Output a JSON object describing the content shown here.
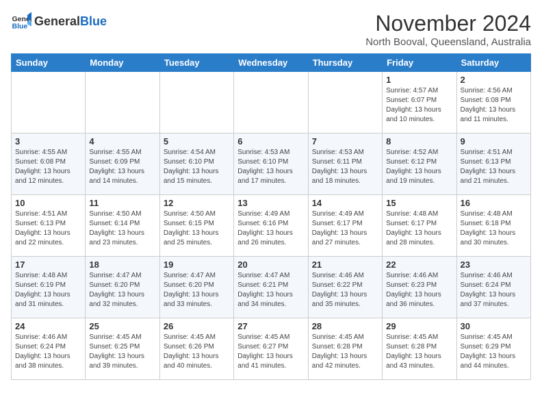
{
  "header": {
    "logo_general": "General",
    "logo_blue": "Blue",
    "month": "November 2024",
    "location": "North Booval, Queensland, Australia"
  },
  "weekdays": [
    "Sunday",
    "Monday",
    "Tuesday",
    "Wednesday",
    "Thursday",
    "Friday",
    "Saturday"
  ],
  "weeks": [
    [
      {
        "day": "",
        "info": ""
      },
      {
        "day": "",
        "info": ""
      },
      {
        "day": "",
        "info": ""
      },
      {
        "day": "",
        "info": ""
      },
      {
        "day": "",
        "info": ""
      },
      {
        "day": "1",
        "info": "Sunrise: 4:57 AM\nSunset: 6:07 PM\nDaylight: 13 hours\nand 10 minutes."
      },
      {
        "day": "2",
        "info": "Sunrise: 4:56 AM\nSunset: 6:08 PM\nDaylight: 13 hours\nand 11 minutes."
      }
    ],
    [
      {
        "day": "3",
        "info": "Sunrise: 4:55 AM\nSunset: 6:08 PM\nDaylight: 13 hours\nand 12 minutes."
      },
      {
        "day": "4",
        "info": "Sunrise: 4:55 AM\nSunset: 6:09 PM\nDaylight: 13 hours\nand 14 minutes."
      },
      {
        "day": "5",
        "info": "Sunrise: 4:54 AM\nSunset: 6:10 PM\nDaylight: 13 hours\nand 15 minutes."
      },
      {
        "day": "6",
        "info": "Sunrise: 4:53 AM\nSunset: 6:10 PM\nDaylight: 13 hours\nand 17 minutes."
      },
      {
        "day": "7",
        "info": "Sunrise: 4:53 AM\nSunset: 6:11 PM\nDaylight: 13 hours\nand 18 minutes."
      },
      {
        "day": "8",
        "info": "Sunrise: 4:52 AM\nSunset: 6:12 PM\nDaylight: 13 hours\nand 19 minutes."
      },
      {
        "day": "9",
        "info": "Sunrise: 4:51 AM\nSunset: 6:13 PM\nDaylight: 13 hours\nand 21 minutes."
      }
    ],
    [
      {
        "day": "10",
        "info": "Sunrise: 4:51 AM\nSunset: 6:13 PM\nDaylight: 13 hours\nand 22 minutes."
      },
      {
        "day": "11",
        "info": "Sunrise: 4:50 AM\nSunset: 6:14 PM\nDaylight: 13 hours\nand 23 minutes."
      },
      {
        "day": "12",
        "info": "Sunrise: 4:50 AM\nSunset: 6:15 PM\nDaylight: 13 hours\nand 25 minutes."
      },
      {
        "day": "13",
        "info": "Sunrise: 4:49 AM\nSunset: 6:16 PM\nDaylight: 13 hours\nand 26 minutes."
      },
      {
        "day": "14",
        "info": "Sunrise: 4:49 AM\nSunset: 6:17 PM\nDaylight: 13 hours\nand 27 minutes."
      },
      {
        "day": "15",
        "info": "Sunrise: 4:48 AM\nSunset: 6:17 PM\nDaylight: 13 hours\nand 28 minutes."
      },
      {
        "day": "16",
        "info": "Sunrise: 4:48 AM\nSunset: 6:18 PM\nDaylight: 13 hours\nand 30 minutes."
      }
    ],
    [
      {
        "day": "17",
        "info": "Sunrise: 4:48 AM\nSunset: 6:19 PM\nDaylight: 13 hours\nand 31 minutes."
      },
      {
        "day": "18",
        "info": "Sunrise: 4:47 AM\nSunset: 6:20 PM\nDaylight: 13 hours\nand 32 minutes."
      },
      {
        "day": "19",
        "info": "Sunrise: 4:47 AM\nSunset: 6:20 PM\nDaylight: 13 hours\nand 33 minutes."
      },
      {
        "day": "20",
        "info": "Sunrise: 4:47 AM\nSunset: 6:21 PM\nDaylight: 13 hours\nand 34 minutes."
      },
      {
        "day": "21",
        "info": "Sunrise: 4:46 AM\nSunset: 6:22 PM\nDaylight: 13 hours\nand 35 minutes."
      },
      {
        "day": "22",
        "info": "Sunrise: 4:46 AM\nSunset: 6:23 PM\nDaylight: 13 hours\nand 36 minutes."
      },
      {
        "day": "23",
        "info": "Sunrise: 4:46 AM\nSunset: 6:24 PM\nDaylight: 13 hours\nand 37 minutes."
      }
    ],
    [
      {
        "day": "24",
        "info": "Sunrise: 4:46 AM\nSunset: 6:24 PM\nDaylight: 13 hours\nand 38 minutes."
      },
      {
        "day": "25",
        "info": "Sunrise: 4:45 AM\nSunset: 6:25 PM\nDaylight: 13 hours\nand 39 minutes."
      },
      {
        "day": "26",
        "info": "Sunrise: 4:45 AM\nSunset: 6:26 PM\nDaylight: 13 hours\nand 40 minutes."
      },
      {
        "day": "27",
        "info": "Sunrise: 4:45 AM\nSunset: 6:27 PM\nDaylight: 13 hours\nand 41 minutes."
      },
      {
        "day": "28",
        "info": "Sunrise: 4:45 AM\nSunset: 6:28 PM\nDaylight: 13 hours\nand 42 minutes."
      },
      {
        "day": "29",
        "info": "Sunrise: 4:45 AM\nSunset: 6:28 PM\nDaylight: 13 hours\nand 43 minutes."
      },
      {
        "day": "30",
        "info": "Sunrise: 4:45 AM\nSunset: 6:29 PM\nDaylight: 13 hours\nand 44 minutes."
      }
    ]
  ]
}
